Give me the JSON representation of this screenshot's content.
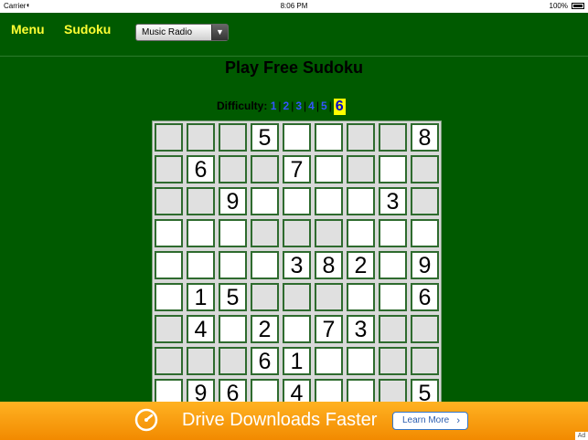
{
  "status_bar": {
    "carrier": "Carrier",
    "time": "8:06 PM",
    "battery": "100%"
  },
  "nav": {
    "menu_label": "Menu",
    "sudoku_label": "Sudoku",
    "station_select": "Music Radio"
  },
  "page": {
    "title": "Play Free Sudoku",
    "difficulty_label": "Difficulty:",
    "levels": [
      "1",
      "2",
      "3",
      "4",
      "5",
      "6"
    ],
    "current_level": "6"
  },
  "board": {
    "rows": [
      [
        "",
        "",
        "",
        "5",
        "",
        "",
        "",
        "",
        "8"
      ],
      [
        "",
        "6",
        "",
        "",
        "7",
        "",
        "",
        "",
        ""
      ],
      [
        "",
        "",
        "9",
        "",
        "",
        "",
        "",
        "3",
        ""
      ],
      [
        "",
        "",
        "",
        "",
        "",
        "",
        "",
        "",
        ""
      ],
      [
        "",
        "",
        "",
        "",
        "3",
        "8",
        "2",
        "",
        "9"
      ],
      [
        "",
        "1",
        "5",
        "",
        "",
        "",
        "",
        "",
        "6"
      ],
      [
        "",
        "4",
        "",
        "2",
        "",
        "7",
        "3",
        "",
        ""
      ],
      [
        "",
        "",
        "",
        "6",
        "1",
        "",
        "",
        "",
        ""
      ],
      [
        "",
        "9",
        "6",
        "",
        "4",
        "",
        "",
        "",
        "5"
      ]
    ],
    "white_cells": [
      [
        0,
        3
      ],
      [
        0,
        4
      ],
      [
        0,
        5
      ],
      [
        0,
        8
      ],
      [
        1,
        1
      ],
      [
        1,
        4
      ],
      [
        1,
        5
      ],
      [
        1,
        7
      ],
      [
        2,
        2
      ],
      [
        2,
        3
      ],
      [
        2,
        4
      ],
      [
        2,
        5
      ],
      [
        2,
        6
      ],
      [
        2,
        7
      ],
      [
        3,
        0
      ],
      [
        3,
        1
      ],
      [
        3,
        2
      ],
      [
        3,
        6
      ],
      [
        3,
        7
      ],
      [
        3,
        8
      ],
      [
        4,
        0
      ],
      [
        4,
        1
      ],
      [
        4,
        2
      ],
      [
        4,
        3
      ],
      [
        4,
        4
      ],
      [
        4,
        5
      ],
      [
        4,
        6
      ],
      [
        4,
        7
      ],
      [
        4,
        8
      ],
      [
        5,
        0
      ],
      [
        5,
        1
      ],
      [
        5,
        2
      ],
      [
        5,
        6
      ],
      [
        5,
        7
      ],
      [
        5,
        8
      ],
      [
        6,
        1
      ],
      [
        6,
        2
      ],
      [
        6,
        3
      ],
      [
        6,
        4
      ],
      [
        6,
        5
      ],
      [
        6,
        6
      ],
      [
        7,
        3
      ],
      [
        7,
        4
      ],
      [
        7,
        5
      ],
      [
        7,
        6
      ],
      [
        8,
        0
      ],
      [
        8,
        1
      ],
      [
        8,
        2
      ],
      [
        8,
        3
      ],
      [
        8,
        4
      ],
      [
        8,
        5
      ],
      [
        8,
        6
      ],
      [
        8,
        8
      ]
    ]
  },
  "ad": {
    "headline": "Drive Downloads Faster",
    "cta": "Learn More",
    "badge": "Ad"
  }
}
